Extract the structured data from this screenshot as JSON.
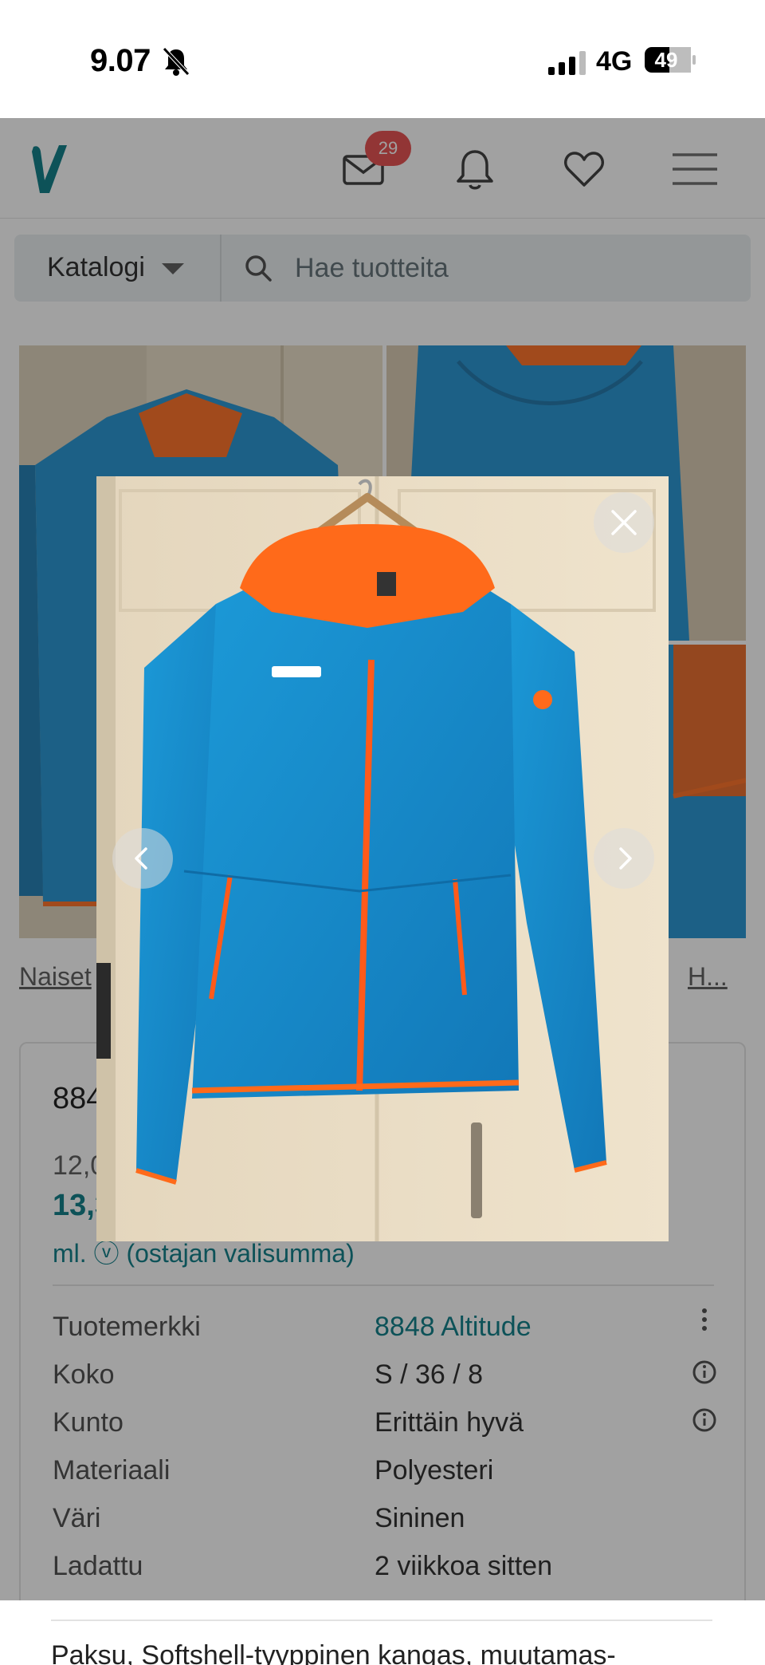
{
  "status_bar": {
    "time": "9.07",
    "network": "4G",
    "battery": "49"
  },
  "header": {
    "logo_letter": "V",
    "inbox_badge": "29"
  },
  "search": {
    "catalog_label": "Katalogi",
    "placeholder": "Hae tuotteita"
  },
  "breadcrumb": {
    "left": "Naiset",
    "right": "H..."
  },
  "item": {
    "title": "884",
    "price_original": "12,0",
    "price_total": "13,3",
    "price_note": "ml. ⓥ (ostajan valisumma)",
    "details": [
      {
        "label": "Tuotemerkki",
        "value": "8848 Altitude"
      },
      {
        "label": "Koko",
        "value": "S / 36 / 8"
      },
      {
        "label": "Kunto",
        "value": "Erittäin hyvä"
      },
      {
        "label": "Materiaali",
        "value": "Polyesteri"
      },
      {
        "label": "Väri",
        "value": "Sininen"
      },
      {
        "label": "Ladattu",
        "value": "2 viikkoa sitten"
      }
    ],
    "description": "Paksu, Softshell-tyyppinen kangas, muutamas-"
  },
  "colors": {
    "brand": "#007782",
    "badge": "#e64545",
    "jacket_blue": "#1a8fd0",
    "jacket_orange": "#ff6a1a"
  }
}
